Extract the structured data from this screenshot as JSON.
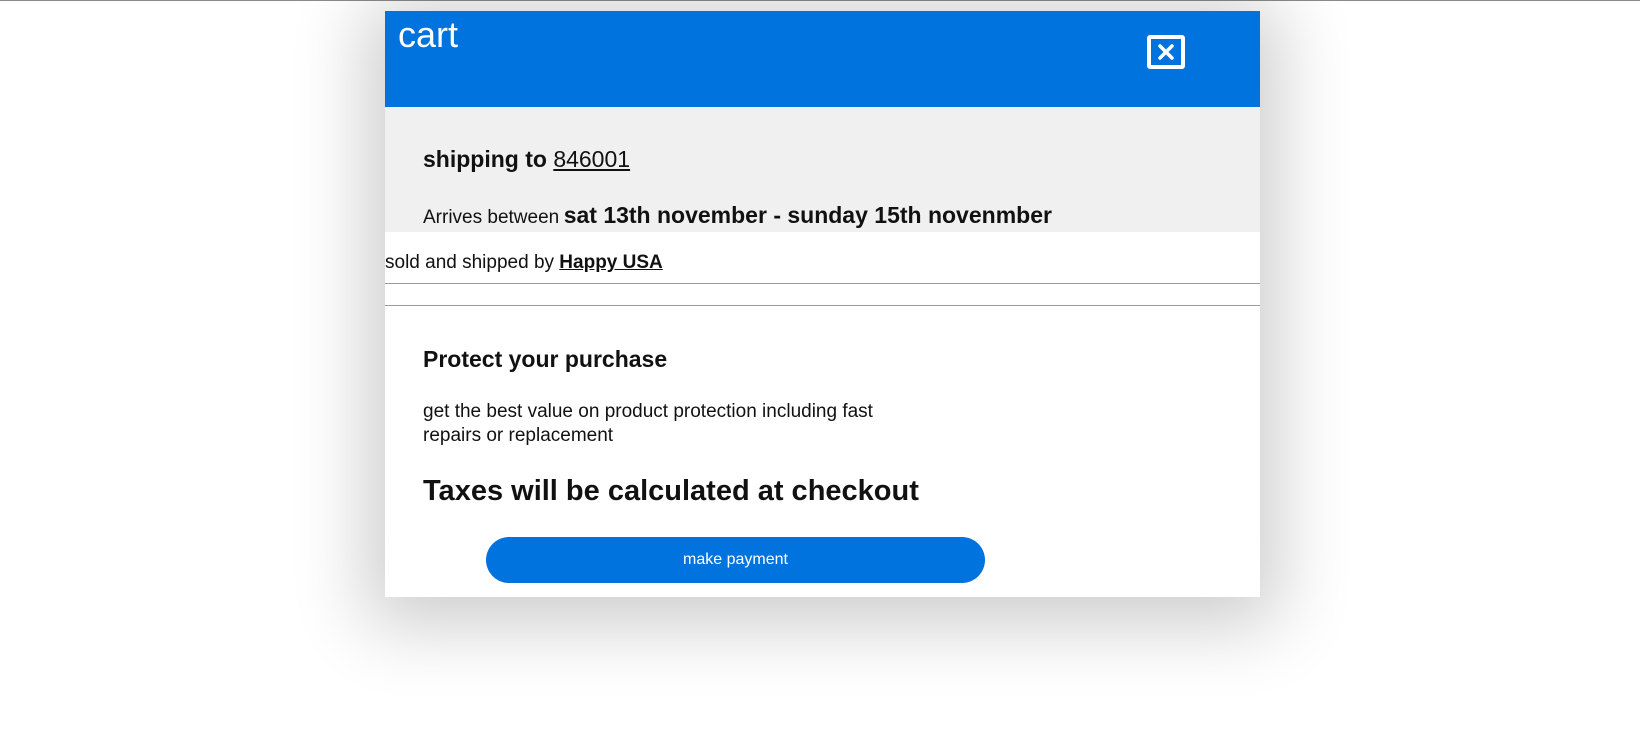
{
  "header": {
    "title": "cart",
    "close_icon": "close-square-icon",
    "accent_color": "#0073de"
  },
  "shipping": {
    "prefix": "shipping to",
    "zip": "846001",
    "arrives_prefix": "Arrives between",
    "arrives_dates": "sat 13th november - sunday 15th novenmber"
  },
  "seller": {
    "prefix": "sold and shipped by",
    "name": "Happy USA"
  },
  "protection": {
    "title": "Protect your purchase",
    "description": "get the best value on product protection including fast repairs or replacement"
  },
  "taxes_note": "Taxes will be calculated at checkout",
  "payment": {
    "button_label": "make payment"
  }
}
